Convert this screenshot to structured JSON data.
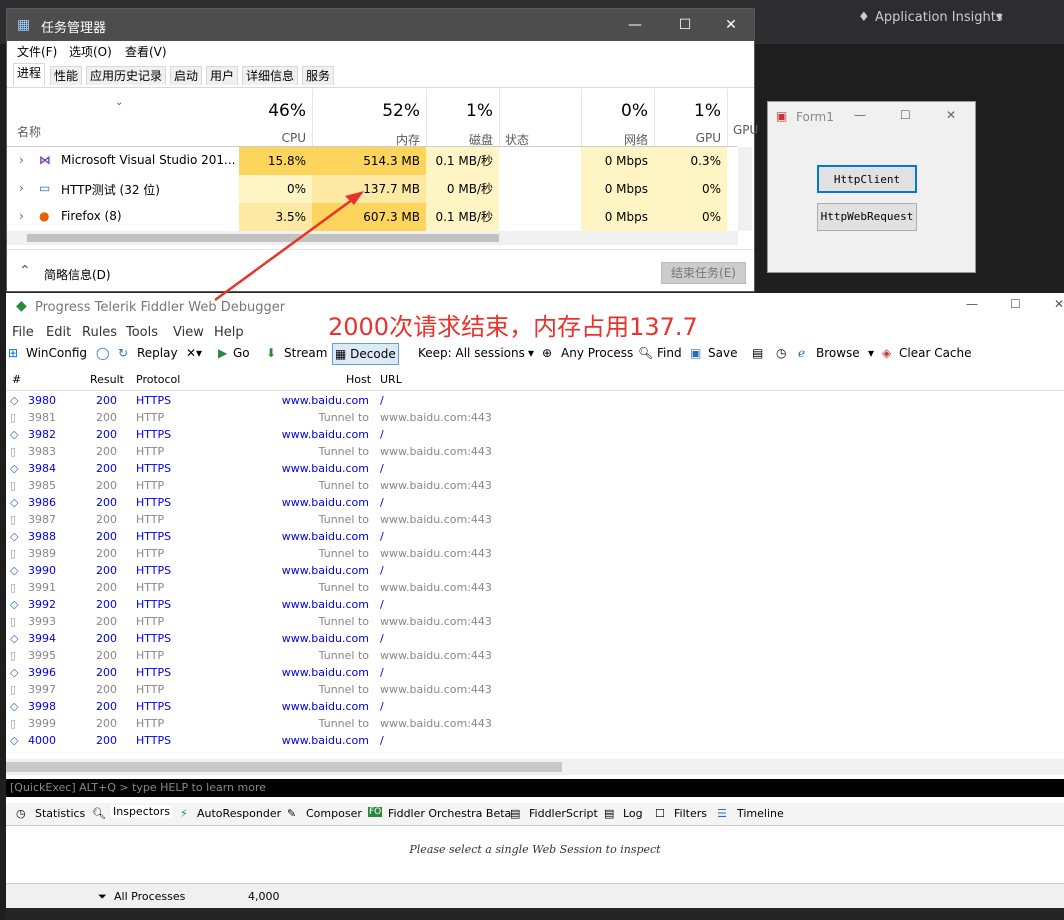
{
  "vs_toolbar": {
    "app_insights": "Application Insights"
  },
  "task_manager": {
    "title": "任务管理器",
    "menu": [
      "文件(F)",
      "选项(O)",
      "查看(V)"
    ],
    "tabs": [
      "进程",
      "性能",
      "应用历史记录",
      "启动",
      "用户",
      "详细信息",
      "服务"
    ],
    "columns": {
      "name": "名称",
      "cpu": {
        "pct": "46%",
        "label": "CPU"
      },
      "memory": {
        "pct": "52%",
        "label": "内存"
      },
      "disk": {
        "pct": "1%",
        "label": "磁盘"
      },
      "status": "状态",
      "network": {
        "pct": "0%",
        "label": "网络"
      },
      "gpu": {
        "pct": "1%",
        "label": "GPU"
      },
      "gpu2": "GPU"
    },
    "rows": [
      {
        "name": "Microsoft Visual Studio 201...",
        "cpu": "15.8%",
        "mem": "514.3 MB",
        "disk": "0.1 MB/秒",
        "net": "0 Mbps",
        "gpu": "0.3%"
      },
      {
        "name": "HTTP测试 (32 位)",
        "cpu": "0%",
        "mem": "137.7 MB",
        "disk": "0 MB/秒",
        "net": "0 Mbps",
        "gpu": "0%"
      },
      {
        "name": "Firefox (8)",
        "cpu": "3.5%",
        "mem": "607.3 MB",
        "disk": "0.1 MB/秒",
        "net": "0 Mbps",
        "gpu": "0%"
      }
    ],
    "fewer_details": "简略信息(D)",
    "end_task": "结束任务(E)"
  },
  "form1": {
    "title": "Form1",
    "btn1": "HttpClient",
    "btn2": "HttpWebRequest"
  },
  "annotation": "2000次请求结束，内存占用137.7",
  "fiddler": {
    "title": "Progress Telerik Fiddler Web Debugger",
    "menu": [
      "File",
      "Edit",
      "Rules",
      "Tools",
      "View",
      "Help"
    ],
    "toolbar": {
      "winconfig": "WinConfig",
      "replay": "Replay",
      "go": "Go",
      "stream": "Stream",
      "decode": "Decode",
      "keep": "Keep: All sessions",
      "process": "Any Process",
      "find": "Find",
      "save": "Save",
      "browse": "Browse",
      "clear_cache": "Clear Cache"
    },
    "columns": {
      "num": "#",
      "result": "Result",
      "protocol": "Protocol",
      "host": "Host",
      "url": "URL"
    },
    "sessions": [
      {
        "id": "3980",
        "result": "200",
        "protocol": "HTTPS",
        "host": "www.baidu.com",
        "url": "/"
      },
      {
        "id": "3981",
        "result": "200",
        "protocol": "HTTP",
        "host": "Tunnel to",
        "url": "www.baidu.com:443"
      },
      {
        "id": "3982",
        "result": "200",
        "protocol": "HTTPS",
        "host": "www.baidu.com",
        "url": "/"
      },
      {
        "id": "3983",
        "result": "200",
        "protocol": "HTTP",
        "host": "Tunnel to",
        "url": "www.baidu.com:443"
      },
      {
        "id": "3984",
        "result": "200",
        "protocol": "HTTPS",
        "host": "www.baidu.com",
        "url": "/"
      },
      {
        "id": "3985",
        "result": "200",
        "protocol": "HTTP",
        "host": "Tunnel to",
        "url": "www.baidu.com:443"
      },
      {
        "id": "3986",
        "result": "200",
        "protocol": "HTTPS",
        "host": "www.baidu.com",
        "url": "/"
      },
      {
        "id": "3987",
        "result": "200",
        "protocol": "HTTP",
        "host": "Tunnel to",
        "url": "www.baidu.com:443"
      },
      {
        "id": "3988",
        "result": "200",
        "protocol": "HTTPS",
        "host": "www.baidu.com",
        "url": "/"
      },
      {
        "id": "3989",
        "result": "200",
        "protocol": "HTTP",
        "host": "Tunnel to",
        "url": "www.baidu.com:443"
      },
      {
        "id": "3990",
        "result": "200",
        "protocol": "HTTPS",
        "host": "www.baidu.com",
        "url": "/"
      },
      {
        "id": "3991",
        "result": "200",
        "protocol": "HTTP",
        "host": "Tunnel to",
        "url": "www.baidu.com:443"
      },
      {
        "id": "3992",
        "result": "200",
        "protocol": "HTTPS",
        "host": "www.baidu.com",
        "url": "/"
      },
      {
        "id": "3993",
        "result": "200",
        "protocol": "HTTP",
        "host": "Tunnel to",
        "url": "www.baidu.com:443"
      },
      {
        "id": "3994",
        "result": "200",
        "protocol": "HTTPS",
        "host": "www.baidu.com",
        "url": "/"
      },
      {
        "id": "3995",
        "result": "200",
        "protocol": "HTTP",
        "host": "Tunnel to",
        "url": "www.baidu.com:443"
      },
      {
        "id": "3996",
        "result": "200",
        "protocol": "HTTPS",
        "host": "www.baidu.com",
        "url": "/"
      },
      {
        "id": "3997",
        "result": "200",
        "protocol": "HTTP",
        "host": "Tunnel to",
        "url": "www.baidu.com:443"
      },
      {
        "id": "3998",
        "result": "200",
        "protocol": "HTTPS",
        "host": "www.baidu.com",
        "url": "/"
      },
      {
        "id": "3999",
        "result": "200",
        "protocol": "HTTP",
        "host": "Tunnel to",
        "url": "www.baidu.com:443"
      },
      {
        "id": "4000",
        "result": "200",
        "protocol": "HTTPS",
        "host": "www.baidu.com",
        "url": "/"
      }
    ],
    "quickexec": "[QuickExec] ALT+Q > type HELP to learn more",
    "bottom_tabs": [
      "Statistics",
      "Inspectors",
      "AutoResponder",
      "Composer",
      "Fiddler Orchestra Beta",
      "FiddlerScript",
      "Log",
      "Filters",
      "Timeline"
    ],
    "inspect_msg": "Please select a single Web Session to inspect",
    "status": {
      "processes": "All Processes",
      "count": "4,000"
    }
  }
}
